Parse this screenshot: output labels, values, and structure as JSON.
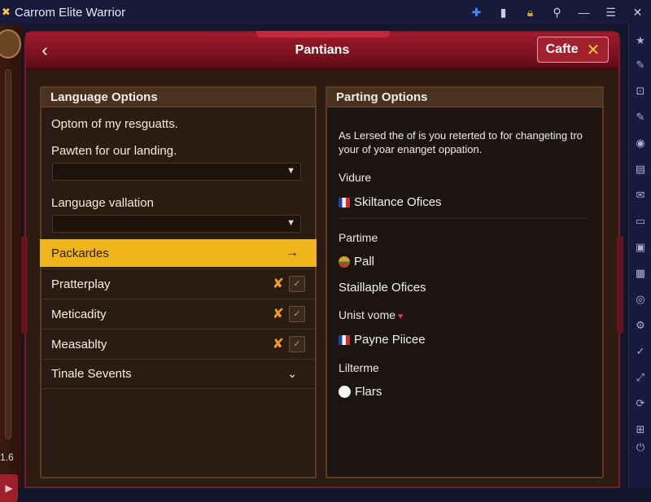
{
  "window": {
    "title": "Carrom Elite Warrior",
    "icons": [
      "puzzle-icon",
      "file-icon",
      "lock-icon",
      "search-icon",
      "minimize-icon",
      "menu-icon",
      "close-icon"
    ]
  },
  "left_strip": {
    "value": "1.6"
  },
  "dialog": {
    "title": "Pantians",
    "close_label": "Cafte"
  },
  "language": {
    "heading": "Language Options",
    "line1": "Optom of my resguatts.",
    "line2": "Pawten for our landing.",
    "select1_value": "",
    "line3": "Language vallation",
    "select2_value": "",
    "rows": [
      {
        "label": "Packardes",
        "state": "active"
      },
      {
        "label": "Pratterplay",
        "state": "x"
      },
      {
        "label": "Meticadity",
        "state": "x"
      },
      {
        "label": "Measablty",
        "state": "x"
      },
      {
        "label": "Tinale Sevents",
        "state": "expand"
      }
    ]
  },
  "parting": {
    "heading": "Parting Options",
    "description": "As Lersed the of is you reterted to for changeting tro your of yoar enanget oppation.",
    "label1": "Vidure",
    "item1": "Skiltance Ofices",
    "label2": "Partime",
    "item2": "Pall",
    "item3": "Staillaple Ofices",
    "label3": "Unist vome",
    "item4": "Payne Piicee",
    "label4": "Lilterme",
    "item5": "Flars"
  },
  "colors": {
    "header_red": "#a2192a",
    "active_row": "#f0b51a",
    "panel_bg": "#2d1a10"
  }
}
